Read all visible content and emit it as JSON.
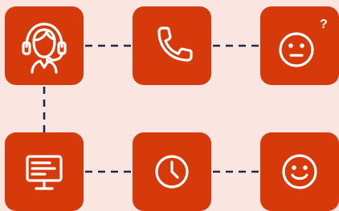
{
  "colors": {
    "background": "#fbe5e0",
    "tile": "#d63a0a",
    "icon": "#ffffff",
    "connector": "#1f2a44"
  },
  "nodes": [
    {
      "id": "agent",
      "icon": "headset-agent-icon"
    },
    {
      "id": "phone",
      "icon": "phone-icon"
    },
    {
      "id": "confused",
      "icon": "confused-face-icon",
      "badge": "?"
    },
    {
      "id": "monitor",
      "icon": "monitor-icon"
    },
    {
      "id": "clock",
      "icon": "clock-icon"
    },
    {
      "id": "happy",
      "icon": "happy-face-icon"
    }
  ],
  "edges": [
    {
      "from": "agent",
      "to": "phone",
      "style": "dashed"
    },
    {
      "from": "phone",
      "to": "confused",
      "style": "dashed"
    },
    {
      "from": "agent",
      "to": "monitor",
      "style": "dashed"
    },
    {
      "from": "monitor",
      "to": "clock",
      "style": "dashed"
    },
    {
      "from": "clock",
      "to": "happy",
      "style": "dashed"
    }
  ]
}
